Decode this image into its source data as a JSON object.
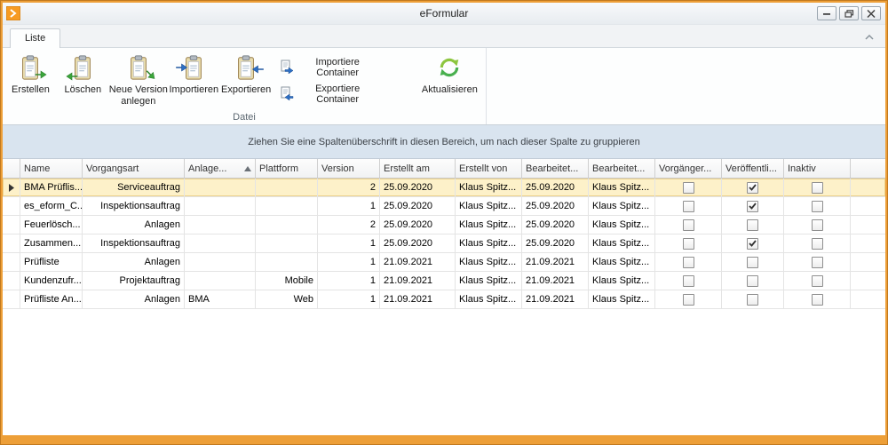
{
  "window": {
    "title": "eFormular"
  },
  "ribbon": {
    "tab": "Liste",
    "group_label": "Datei",
    "large_buttons": [
      {
        "label": "Erstellen"
      },
      {
        "label": "Löschen"
      },
      {
        "label": "Neue Version anlegen"
      },
      {
        "label": "Importieren"
      },
      {
        "label": "Exportieren"
      }
    ],
    "small_buttons": [
      {
        "label": "Importiere Container"
      },
      {
        "label": "Exportiere Container"
      }
    ],
    "refresh_button": {
      "label": "Aktualisieren"
    }
  },
  "grid": {
    "groupby_text": "Ziehen Sie eine Spaltenüberschrift in diesen Bereich, um nach dieser Spalte zu gruppieren",
    "columns": [
      "Name",
      "Vorgangsart",
      "Anlage...",
      "Plattform",
      "Version",
      "Erstellt am",
      "Erstellt von",
      "Bearbeitet...",
      "Bearbeitet...",
      "Vorgänger...",
      "Veröffentli...",
      "Inaktiv"
    ],
    "sorted_column": 2,
    "sort_direction": "ascending",
    "selected_row": 0,
    "rows": [
      {
        "name": "BMA Prüflis...",
        "vorgangsart": "Serviceauftrag",
        "anlage": "",
        "plattform": "",
        "version": "2",
        "erstellt_am": "25.09.2020",
        "erstellt_von": "Klaus Spitz...",
        "bearbeitet_am": "25.09.2020",
        "bearbeitet_von": "Klaus Spitz...",
        "vorgaenger": false,
        "veroeffentlicht": true,
        "inaktiv": false
      },
      {
        "name": "es_eform_C...",
        "vorgangsart": "Inspektionsauftrag",
        "anlage": "",
        "plattform": "",
        "version": "1",
        "erstellt_am": "25.09.2020",
        "erstellt_von": "Klaus Spitz...",
        "bearbeitet_am": "25.09.2020",
        "bearbeitet_von": "Klaus Spitz...",
        "vorgaenger": false,
        "veroeffentlicht": true,
        "inaktiv": false
      },
      {
        "name": "Feuerlösch...",
        "vorgangsart": "Anlagen",
        "anlage": "",
        "plattform": "",
        "version": "2",
        "erstellt_am": "25.09.2020",
        "erstellt_von": "Klaus Spitz...",
        "bearbeitet_am": "25.09.2020",
        "bearbeitet_von": "Klaus Spitz...",
        "vorgaenger": false,
        "veroeffentlicht": false,
        "inaktiv": false
      },
      {
        "name": "Zusammen...",
        "vorgangsart": "Inspektionsauftrag",
        "anlage": "",
        "plattform": "",
        "version": "1",
        "erstellt_am": "25.09.2020",
        "erstellt_von": "Klaus Spitz...",
        "bearbeitet_am": "25.09.2020",
        "bearbeitet_von": "Klaus Spitz...",
        "vorgaenger": false,
        "veroeffentlicht": true,
        "inaktiv": false
      },
      {
        "name": "Prüfliste",
        "vorgangsart": "Anlagen",
        "anlage": "",
        "plattform": "",
        "version": "1",
        "erstellt_am": "21.09.2021",
        "erstellt_von": "Klaus Spitz...",
        "bearbeitet_am": "21.09.2021",
        "bearbeitet_von": "Klaus Spitz...",
        "vorgaenger": false,
        "veroeffentlicht": false,
        "inaktiv": false
      },
      {
        "name": "Kundenzufr...",
        "vorgangsart": "Projektauftrag",
        "anlage": "",
        "plattform": "Mobile",
        "version": "1",
        "erstellt_am": "21.09.2021",
        "erstellt_von": "Klaus Spitz...",
        "bearbeitet_am": "21.09.2021",
        "bearbeitet_von": "Klaus Spitz...",
        "vorgaenger": false,
        "veroeffentlicht": false,
        "inaktiv": false
      },
      {
        "name": "Prüfliste An...",
        "vorgangsart": "Anlagen",
        "anlage": "BMA",
        "plattform": "Web",
        "version": "1",
        "erstellt_am": "21.09.2021",
        "erstellt_von": "Klaus Spitz...",
        "bearbeitet_am": "21.09.2021",
        "bearbeitet_von": "Klaus Spitz...",
        "vorgaenger": false,
        "veroeffentlicht": false,
        "inaktiv": false
      }
    ]
  },
  "colors": {
    "frame_orange": "#ED9F38",
    "selected_row": "#FDF1C9",
    "groupby_bg": "#D9E4EF",
    "green_accent": "#3AA63A",
    "blue_accent": "#2D6FC4"
  }
}
